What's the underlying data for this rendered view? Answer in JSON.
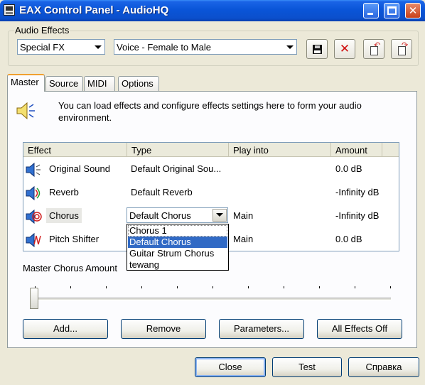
{
  "window": {
    "title": "EAX Control Panel - AudioHQ"
  },
  "audio_effects": {
    "group_label": "Audio Effects",
    "category": "Special FX",
    "preset": "Voice - Female to Male"
  },
  "toolbar_icons": [
    "save-icon",
    "delete-icon",
    "import-icon",
    "export-icon"
  ],
  "tabs": [
    {
      "label": "Master",
      "active": true
    },
    {
      "label": "Source",
      "active": false
    },
    {
      "label": "MIDI",
      "active": false
    },
    {
      "label": "Options",
      "active": false
    }
  ],
  "info_text": "You can load effects and configure effects settings here to form your audio environment.",
  "table": {
    "headers": [
      "Effect",
      "Type",
      "Play into",
      "Amount"
    ],
    "rows": [
      {
        "effect": "Original Sound",
        "type": "Default Original Sou...",
        "play_into": "",
        "amount": "0.0 dB",
        "icon": "speaker-icon"
      },
      {
        "effect": "Reverb",
        "type": "Default Reverb",
        "play_into": "",
        "amount": "-Infinity dB",
        "icon": "reverb-icon"
      },
      {
        "effect": "Chorus",
        "type": "Default Chorus",
        "play_into": "Main",
        "amount": "-Infinity dB",
        "icon": "chorus-icon"
      },
      {
        "effect": "Pitch Shifter",
        "type": "",
        "play_into": "Main",
        "amount": "0.0 dB",
        "icon": "pitch-shifter-icon"
      }
    ]
  },
  "type_dropdown": {
    "options": [
      "Chorus 1",
      "Default Chorus",
      "Guitar Strum Chorus",
      "tewang"
    ],
    "selected": "Default Chorus"
  },
  "slider": {
    "label": "Master Chorus Amount",
    "value": 0
  },
  "buttons": {
    "add": "Add...",
    "remove": "Remove",
    "parameters": "Parameters...",
    "all_effects_off": "All Effects Off",
    "close": "Close",
    "test": "Test",
    "help": "Справка"
  },
  "colors": {
    "selection": "#316ac5",
    "titlebar": "#0a55d8"
  }
}
